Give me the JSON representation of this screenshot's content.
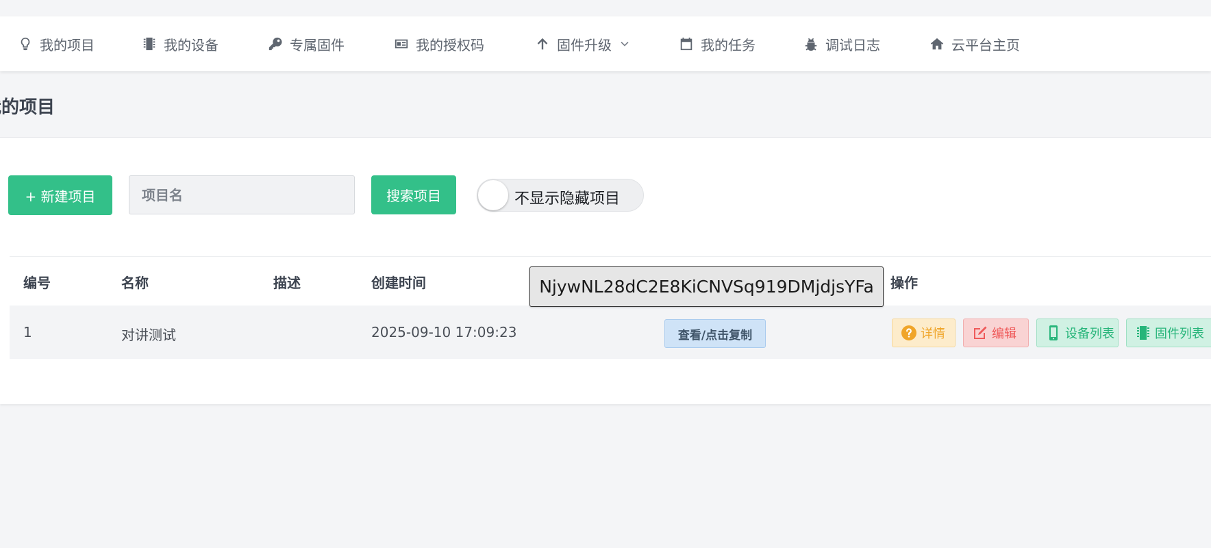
{
  "nav": {
    "items": [
      {
        "label": "我的项目",
        "icon": "lightbulb-icon"
      },
      {
        "label": "我的设备",
        "icon": "chip-icon"
      },
      {
        "label": "专属固件",
        "icon": "key-icon"
      },
      {
        "label": "我的授权码",
        "icon": "id-card-icon"
      },
      {
        "label": "固件升级",
        "icon": "arrow-up-icon"
      },
      {
        "label": "我的任务",
        "icon": "calendar-icon"
      },
      {
        "label": "调试日志",
        "icon": "bug-icon"
      },
      {
        "label": "云平台主页",
        "icon": "home-icon"
      }
    ]
  },
  "page": {
    "title": "我的项目"
  },
  "toolbar": {
    "new_label": "+ 新建项目",
    "search_placeholder": "项目名",
    "search_label": "搜索项目",
    "toggle_label": "不显示隐藏项目",
    "toggle_on": false
  },
  "table": {
    "columns": [
      "编号",
      "名称",
      "描述",
      "创建时间",
      "",
      "操作"
    ],
    "rows": [
      {
        "id": "1",
        "name": "对讲测试",
        "description": "",
        "created": "2025-09-10 17:09:23",
        "copy_label": "查看/点击复制"
      }
    ],
    "actions": {
      "detail": "详情",
      "edit": "编辑",
      "devices": "设备列表",
      "firmware": "固件列表"
    }
  },
  "tooltip": {
    "text": "NjywNL28dC2E8KiCNVSq919DMjdjsYFa"
  },
  "colors": {
    "primary": "#33c089",
    "warning": "#f0a529",
    "danger": "#ef5a5a",
    "info": "#cfe3f7"
  }
}
